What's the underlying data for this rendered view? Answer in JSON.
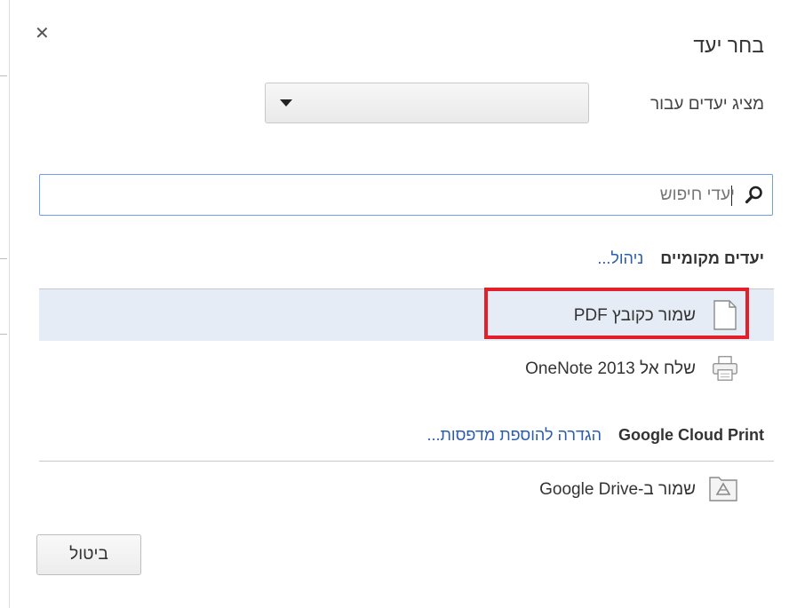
{
  "dialog": {
    "title": "בחר יעד",
    "close_icon": "close-icon",
    "show_destinations_label": "מציג יעדים עבור",
    "account_select_value": ""
  },
  "search": {
    "placeholder": "יעדי חיפוש",
    "value": "",
    "icon": "search-icon"
  },
  "local_destinations": {
    "heading": "יעדים מקומיים",
    "manage_link": "ניהול...",
    "items": [
      {
        "label": "שמור כקובץ PDF",
        "icon": "document-icon",
        "selected": true
      },
      {
        "label": "שלח אל OneNote 2013",
        "icon": "printer-icon",
        "selected": false
      }
    ]
  },
  "cloud_print": {
    "heading": "Google Cloud Print",
    "setup_link": "הגדרה להוספת מדפסות...",
    "items": [
      {
        "label": "שמור ב-Google Drive",
        "icon": "google-drive-icon"
      }
    ]
  },
  "buttons": {
    "cancel_label": "ביטול"
  },
  "colors": {
    "link": "#2a5db0",
    "selected_row": "#e6ecf6",
    "highlight_border": "#e3202a",
    "search_border": "#6d9ee8"
  }
}
